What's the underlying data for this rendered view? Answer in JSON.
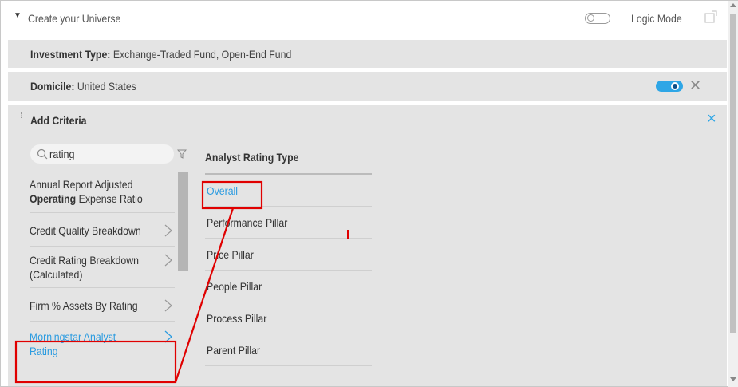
{
  "header": {
    "title": "Create your Universe",
    "logic_mode_label": "Logic Mode",
    "logic_mode_on": false
  },
  "filters": [
    {
      "label": "Investment Type:",
      "value": "Exchange-Traded Fund, Open-End Fund"
    },
    {
      "label": "Domicile:",
      "value": "United States",
      "enabled": true
    }
  ],
  "criteria": {
    "title": "Add Criteria",
    "search": {
      "value": "rating"
    },
    "results": [
      {
        "line1_pre": "Annual Report Adjusted",
        "line1_bold": "",
        "line2_bold": "Operating",
        "line2_rest": " Expense Ratio"
      },
      {
        "text": "Credit Quality Breakdown"
      },
      {
        "line1": "Credit Rating Breakdown",
        "line2": "(Calculated)"
      },
      {
        "text": "Firm % Assets By Rating"
      },
      {
        "line1": "Morningstar Analyst",
        "line2": "Rating",
        "selected": true
      }
    ],
    "detail": {
      "header": "Analyst Rating Type",
      "options": [
        "Overall",
        "Performance Pillar",
        "Price Pillar",
        "People Pillar",
        "Process Pillar",
        "Parent Pillar"
      ],
      "selected": "Overall"
    }
  },
  "colors": {
    "accent": "#2ea6e6",
    "annotation": "#e00000",
    "row_bg": "#e4e4e4"
  }
}
